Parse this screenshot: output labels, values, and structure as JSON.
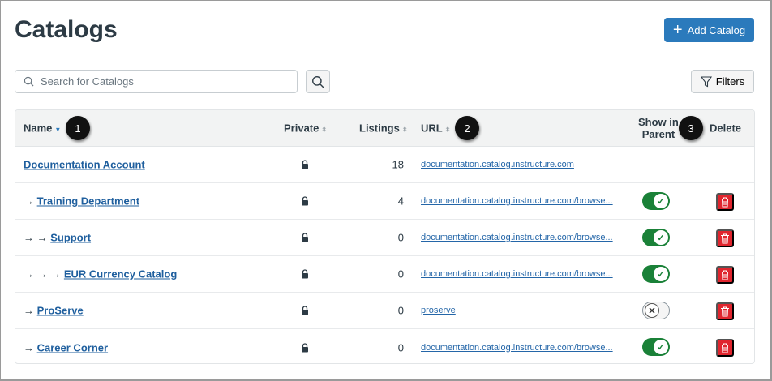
{
  "page": {
    "title": "Catalogs",
    "add_label": "Add Catalog",
    "search_placeholder": "Search for Catalogs",
    "filters_label": "Filters"
  },
  "colors": {
    "accent": "#2b7abc",
    "toggle_on": "#1a8138",
    "delete": "#e0252e"
  },
  "table": {
    "headers": {
      "name": "Name",
      "private": "Private",
      "listings": "Listings",
      "url": "URL",
      "show_in_parent_1": "Show in",
      "show_in_parent_2": "Parent",
      "delete": "Delete"
    },
    "callouts": [
      "1",
      "2",
      "3"
    ],
    "rows": [
      {
        "prefix": "",
        "name": "Documentation Account",
        "private": true,
        "listings": "18",
        "url": "documentation.catalog.instructure.com",
        "show": null,
        "deletable": false
      },
      {
        "prefix": "→",
        "name": "Training Department",
        "private": true,
        "listings": "4",
        "url": "documentation.catalog.instructure.com/browse...",
        "show": true,
        "deletable": true
      },
      {
        "prefix": "→ →",
        "name": "Support",
        "private": true,
        "listings": "0",
        "url": "documentation.catalog.instructure.com/browse...",
        "show": true,
        "deletable": true
      },
      {
        "prefix": "→ → →",
        "name": "EUR Currency Catalog",
        "private": true,
        "listings": "0",
        "url": "documentation.catalog.instructure.com/browse...",
        "show": true,
        "deletable": true
      },
      {
        "prefix": "→",
        "name": "ProServe",
        "private": true,
        "listings": "0",
        "url": "proserve",
        "show": false,
        "deletable": true
      },
      {
        "prefix": "→",
        "name": "Career Corner",
        "private": true,
        "listings": "0",
        "url": "documentation.catalog.instructure.com/browse...",
        "show": true,
        "deletable": true
      }
    ]
  }
}
